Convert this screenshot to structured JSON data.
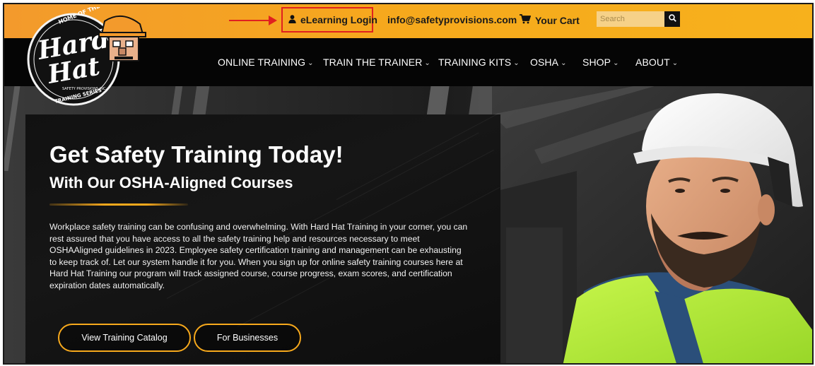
{
  "topbar": {
    "login_label": "eLearning Login",
    "email": "info@safetyprovisions.com",
    "cart_label": "Your Cart",
    "search_placeholder": "Search"
  },
  "logo": {
    "top_text": "HOME OF THE",
    "brand_line1": "Hard",
    "brand_line2": "Hat",
    "sub_text": "SAFETY PROVISIONS INC.",
    "bottom_text": "TRAINING SERIES"
  },
  "nav": {
    "items": [
      {
        "label": "ONLINE TRAINING"
      },
      {
        "label": "TRAIN THE TRAINER"
      },
      {
        "label": "TRAINING KITS"
      },
      {
        "label": "OSHA"
      },
      {
        "label": "SHOP"
      },
      {
        "label": "ABOUT"
      }
    ]
  },
  "hero": {
    "title": "Get Safety Training Today!",
    "subtitle": "With Our OSHA-Aligned Courses",
    "body": "Workplace safety training can be confusing and overwhelming. With Hard Hat Training in your corner, you can rest assured that you have access to all the safety training help and resources necessary to meet OSHAAligned guidelines in 2023. Employee safety certification training and management can be exhausting to keep track of. Let our system handle it for you. When you sign up for online safety training courses here at Hard Hat Training our program will track assigned course, course progress, exam scores, and certification expiration dates automatically.",
    "buttons": [
      {
        "label": "View Training Catalog"
      },
      {
        "label": "For Businesses"
      }
    ]
  },
  "colors": {
    "accent": "#f7a91c",
    "highlight": "#e02020",
    "vest": "#b6f23a",
    "helmet": "#f4f4f4"
  },
  "icons": {
    "login": "user-icon",
    "cart": "cart-icon",
    "search": "search-icon",
    "annotation": "arrow-right-icon",
    "dropdown": "chevron-down-icon"
  }
}
